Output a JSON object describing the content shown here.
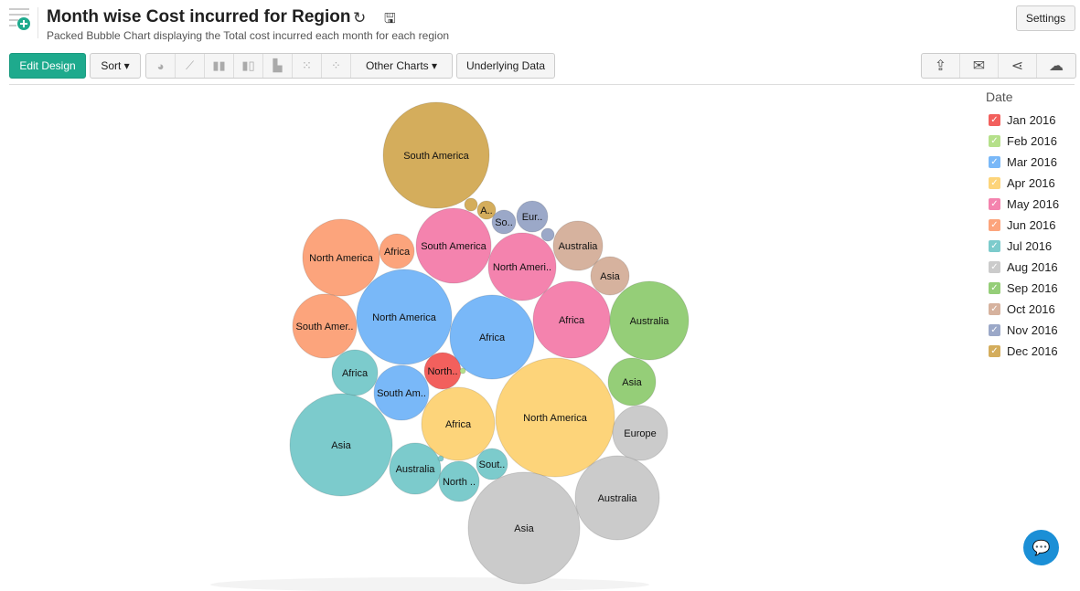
{
  "header": {
    "title": "Month wise Cost incurred for Region",
    "subtitle": "Packed Bubble Chart displaying the Total cost incurred each month for each region",
    "settings_label": "Settings"
  },
  "toolbar": {
    "edit_design": "Edit Design",
    "sort": "Sort ▾",
    "other_charts": "Other Charts ▾",
    "underlying_data": "Underlying Data"
  },
  "chart_data": {
    "type": "packed-bubble",
    "title": "Month wise Cost incurred for Region",
    "legend_title": "Date",
    "legend_position": "right",
    "legend": [
      {
        "label": "Jan 2016",
        "color": "#f2605d"
      },
      {
        "label": "Feb 2016",
        "color": "#b5e08a"
      },
      {
        "label": "Mar 2016",
        "color": "#79b8f8"
      },
      {
        "label": "Apr 2016",
        "color": "#fdd47a"
      },
      {
        "label": "May 2016",
        "color": "#f483ae"
      },
      {
        "label": "Jun 2016",
        "color": "#fca47c"
      },
      {
        "label": "Jul 2016",
        "color": "#7ccbcc"
      },
      {
        "label": "Aug 2016",
        "color": "#cbcbcb"
      },
      {
        "label": "Sep 2016",
        "color": "#95ce78"
      },
      {
        "label": "Oct 2016",
        "color": "#d6b29e"
      },
      {
        "label": "Nov 2016",
        "color": "#9ba8c8"
      },
      {
        "label": "Dec 2016",
        "color": "#d4ad5c"
      }
    ],
    "bubbles": [
      {
        "label": "South America",
        "month": 11,
        "value": 33640
      },
      {
        "label": "",
        "month": 11,
        "value": 490
      },
      {
        "label": "A..",
        "month": 11,
        "value": 1000
      },
      {
        "label": "So..",
        "month": 10,
        "value": 1690
      },
      {
        "label": "Eur..",
        "month": 10,
        "value": 2890
      },
      {
        "label": "",
        "month": 10,
        "value": 490
      },
      {
        "label": "Australia",
        "month": 9,
        "value": 7290
      },
      {
        "label": "Asia",
        "month": 9,
        "value": 4410
      },
      {
        "label": "South America",
        "month": 4,
        "value": 16810
      },
      {
        "label": "North Ameri..",
        "month": 4,
        "value": 13690
      },
      {
        "label": "Africa",
        "month": 4,
        "value": 17640
      },
      {
        "label": "North America",
        "month": 5,
        "value": 17640
      },
      {
        "label": "Africa",
        "month": 5,
        "value": 3610
      },
      {
        "label": "South Amer..",
        "month": 5,
        "value": 12250
      },
      {
        "label": "North America",
        "month": 2,
        "value": 27040
      },
      {
        "label": "Africa",
        "month": 2,
        "value": 21160
      },
      {
        "label": "Australia",
        "month": 8,
        "value": 18490
      },
      {
        "label": "Asia",
        "month": 8,
        "value": 6760
      },
      {
        "label": "Africa",
        "month": 6,
        "value": 6250
      },
      {
        "label": "North..",
        "month": 0,
        "value": 4000
      },
      {
        "label": "",
        "month": 1,
        "value": 90
      },
      {
        "label": "South Am..",
        "month": 2,
        "value": 9000
      },
      {
        "label": "Africa",
        "month": 3,
        "value": 16000
      },
      {
        "label": "North America",
        "month": 3,
        "value": 42250
      },
      {
        "label": "Europe",
        "month": 7,
        "value": 9000
      },
      {
        "label": "Asia",
        "month": 6,
        "value": 31360
      },
      {
        "label": "Australia",
        "month": 6,
        "value": 7840
      },
      {
        "label": "",
        "month": 6,
        "value": 90
      },
      {
        "label": "North ..",
        "month": 6,
        "value": 4840
      },
      {
        "label": "Sout..",
        "month": 6,
        "value": 2890
      },
      {
        "label": "Asia",
        "month": 7,
        "value": 37210
      },
      {
        "label": "Australia",
        "month": 7,
        "value": 21160
      }
    ]
  }
}
